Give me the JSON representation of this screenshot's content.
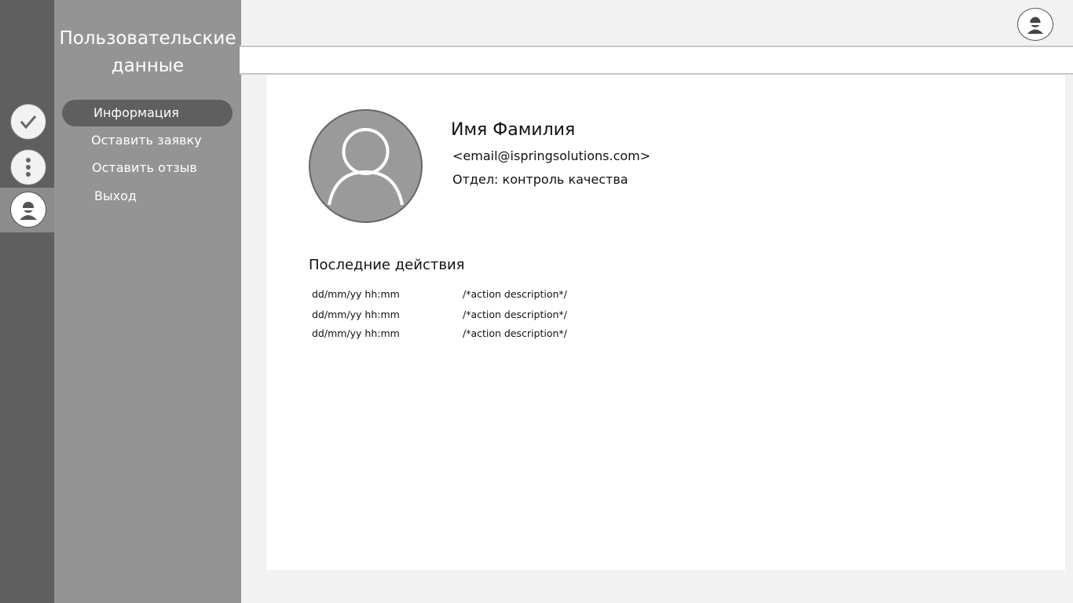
{
  "sidebar": {
    "title_line1": "Пользовательские",
    "title_line2": "данные",
    "items": [
      {
        "label": "Информация",
        "active": true
      },
      {
        "label": "Оставить заявку",
        "active": false
      },
      {
        "label": "Оставить отзыв",
        "active": false
      },
      {
        "label": "Выход",
        "active": false
      }
    ]
  },
  "rail": {
    "icons": [
      "check-icon",
      "more-vertical-icon",
      "user-icon"
    ],
    "active": "user-icon"
  },
  "topbar": {
    "avatar_icon": "user-icon"
  },
  "profile": {
    "name": "Имя Фамилия",
    "email": "<email@ispringsolutions.com>",
    "department": "Отдел: контроль качества"
  },
  "recent": {
    "title": "Последние действия",
    "rows": [
      {
        "date": "dd/mm/yy hh:mm",
        "description": "/*action description*/"
      },
      {
        "date": "dd/mm/yy hh:mm",
        "description": "/*action description*/"
      },
      {
        "date": "dd/mm/yy hh:mm",
        "description": "/*action description*/"
      }
    ]
  },
  "colors": {
    "rail": "#5f5f5f",
    "sidebar": "#949494",
    "active_item": "#5f5f5f",
    "page_bg": "#f2f2f2",
    "content_bg": "#ffffff"
  }
}
